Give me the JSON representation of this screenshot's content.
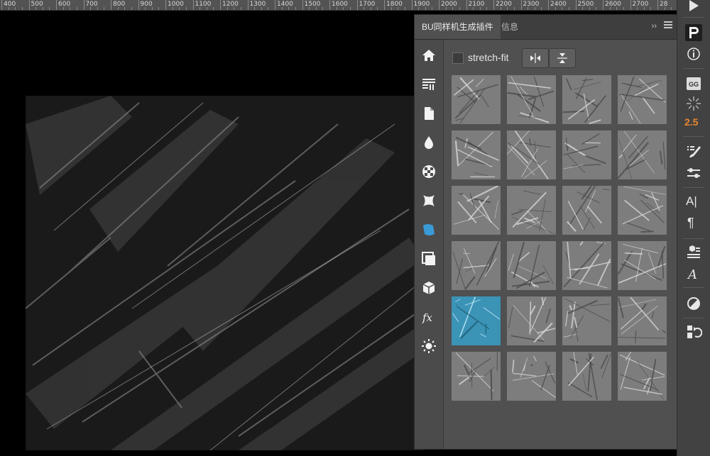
{
  "ruler": {
    "labels": [
      "400",
      "500",
      "600",
      "700",
      "800",
      "900",
      "1000",
      "1100",
      "1200",
      "1300",
      "1400",
      "1500",
      "1600",
      "1700",
      "1800",
      "1900",
      "2000",
      "2100",
      "2200",
      "2300",
      "2400",
      "2500",
      "2600",
      "2700",
      "28"
    ]
  },
  "panel": {
    "active_tab": "BU同样机生成插件",
    "inactive_tab": "信息",
    "collapse_glyph": "››",
    "stretch_fit_label": "stretch-fit",
    "stretch_fit_checked": false,
    "thumbnail_count": 24,
    "selected_thumbnail_index": 16,
    "thumbnail_colors": {
      "default": "#7d7d7d",
      "selected": "#3b93b6"
    }
  },
  "left_tools": [
    "home-icon",
    "patterns-icon",
    "document-icon",
    "drop-icon",
    "checker-icon",
    "warp-icon",
    "fabric-icon",
    "layers-icon",
    "cube-icon",
    "fx-icon",
    "sun-icon"
  ],
  "right_toolbar": {
    "gg_label": "GG",
    "version_label": "2.5",
    "version_color": "#e8882c",
    "text_icon_label": "A|",
    "paragraph_label": "¶"
  }
}
